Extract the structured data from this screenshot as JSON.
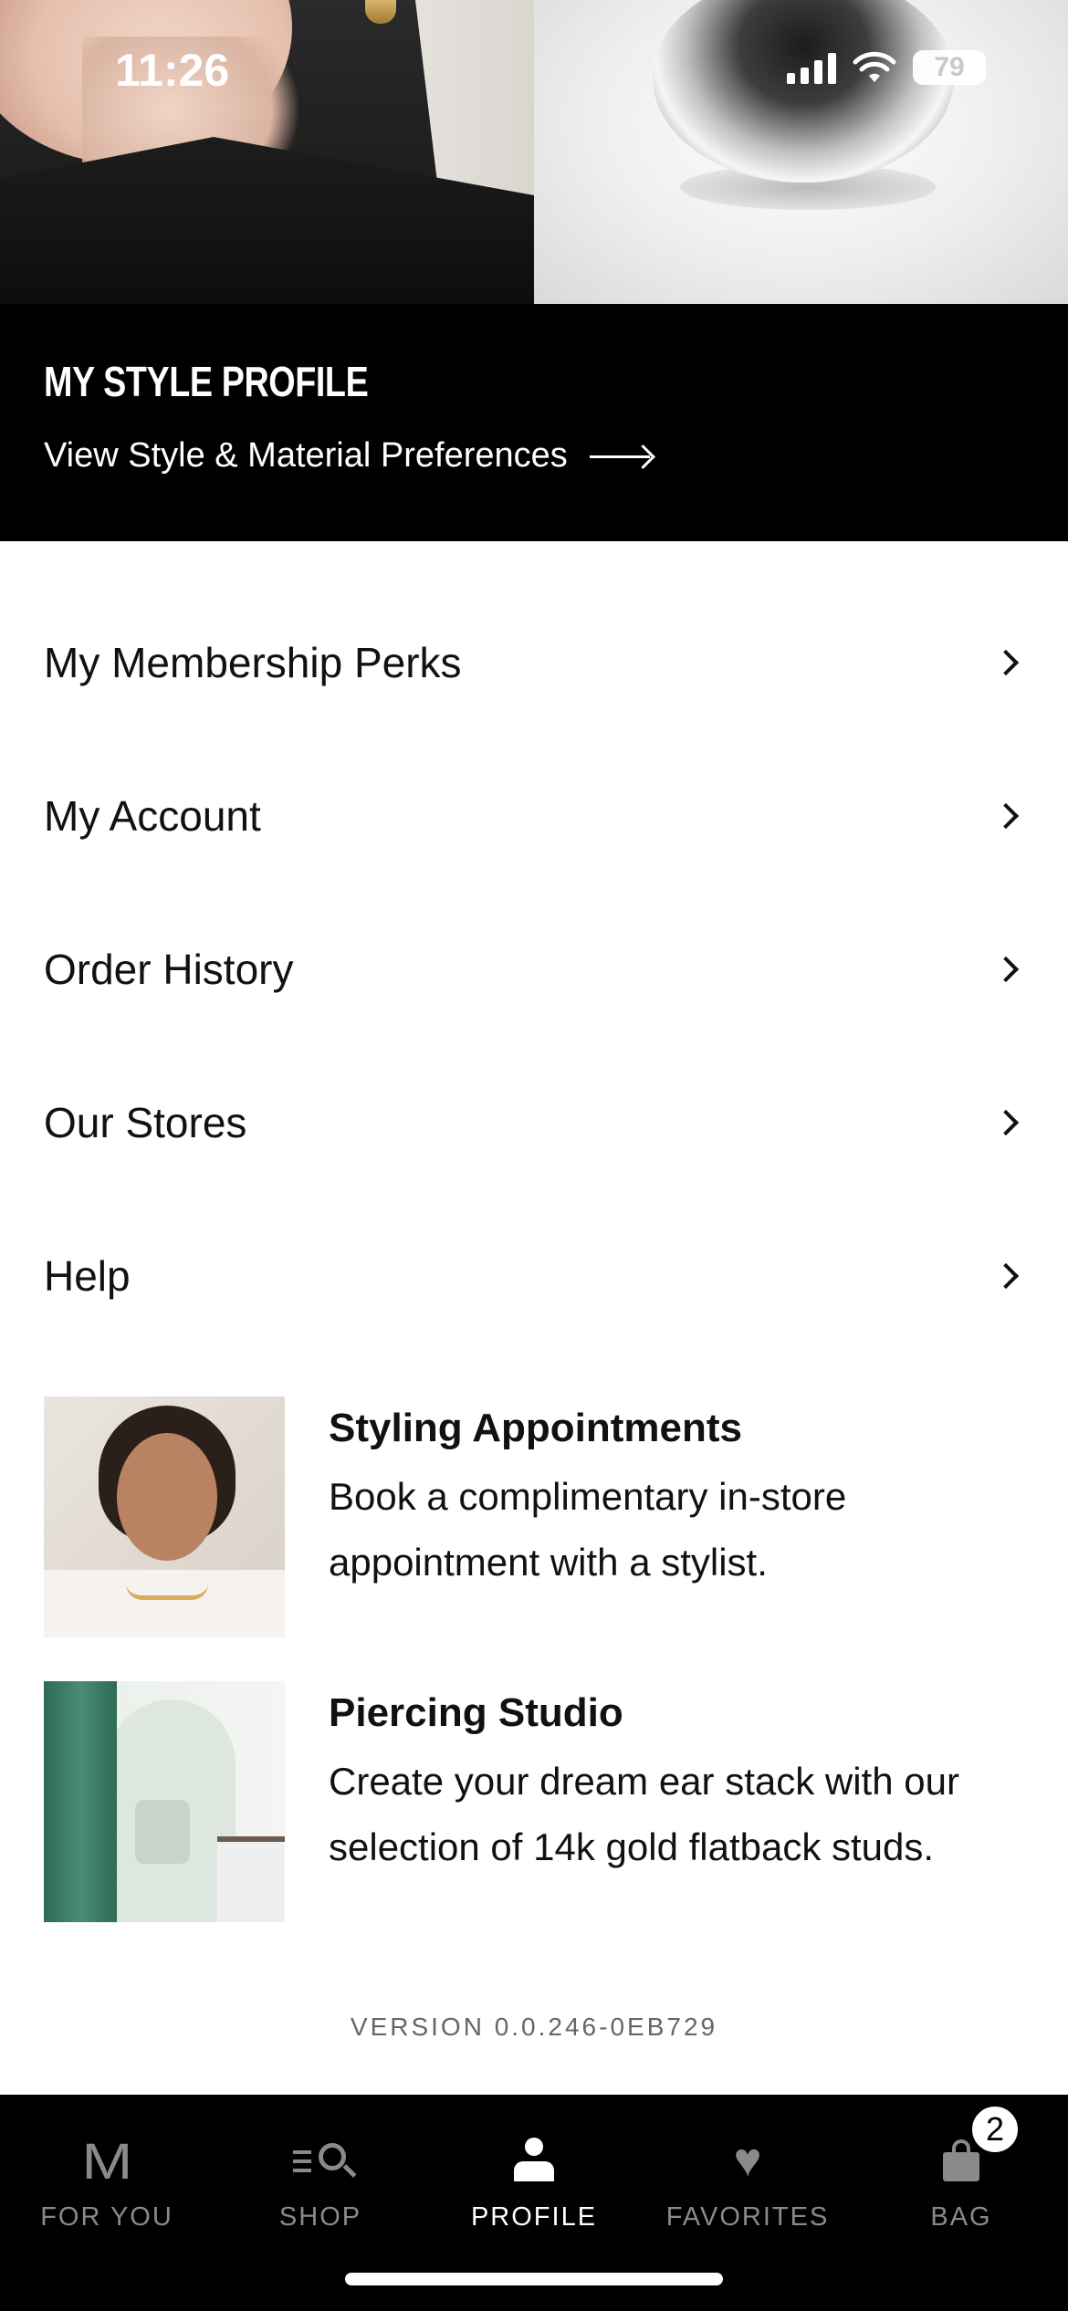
{
  "status_bar": {
    "time": "11:26",
    "battery": "79"
  },
  "style_profile": {
    "title": "MY STYLE PROFILE",
    "link_label": "View Style & Material Preferences"
  },
  "menu": {
    "items": [
      {
        "label": "My Membership Perks"
      },
      {
        "label": "My Account"
      },
      {
        "label": "Order History"
      },
      {
        "label": "Our Stores"
      },
      {
        "label": "Help"
      }
    ]
  },
  "promos": [
    {
      "title": "Styling Appointments",
      "desc_line1": "Book a complimentary in-store",
      "desc_line2": "appointment with a stylist."
    },
    {
      "title": "Piercing Studio",
      "desc_line1": "Create your dream ear stack with our",
      "desc_line2": "selection of 14k gold flatback studs."
    }
  ],
  "version": "VERSION 0.0.246-0EB729",
  "tabbar": {
    "tabs": [
      {
        "label": "FOR YOU",
        "icon": "m-logo-icon"
      },
      {
        "label": "SHOP",
        "icon": "shop-search-icon"
      },
      {
        "label": "PROFILE",
        "icon": "person-icon",
        "active": true
      },
      {
        "label": "FAVORITES",
        "icon": "heart-icon"
      },
      {
        "label": "BAG",
        "icon": "bag-icon"
      }
    ],
    "bag_count": "2",
    "m_glyph": "M",
    "heart_glyph": "♥"
  },
  "colors": {
    "accent": "#000000",
    "inactive_tab": "#8a8a8a",
    "active_tab": "#ffffff"
  }
}
